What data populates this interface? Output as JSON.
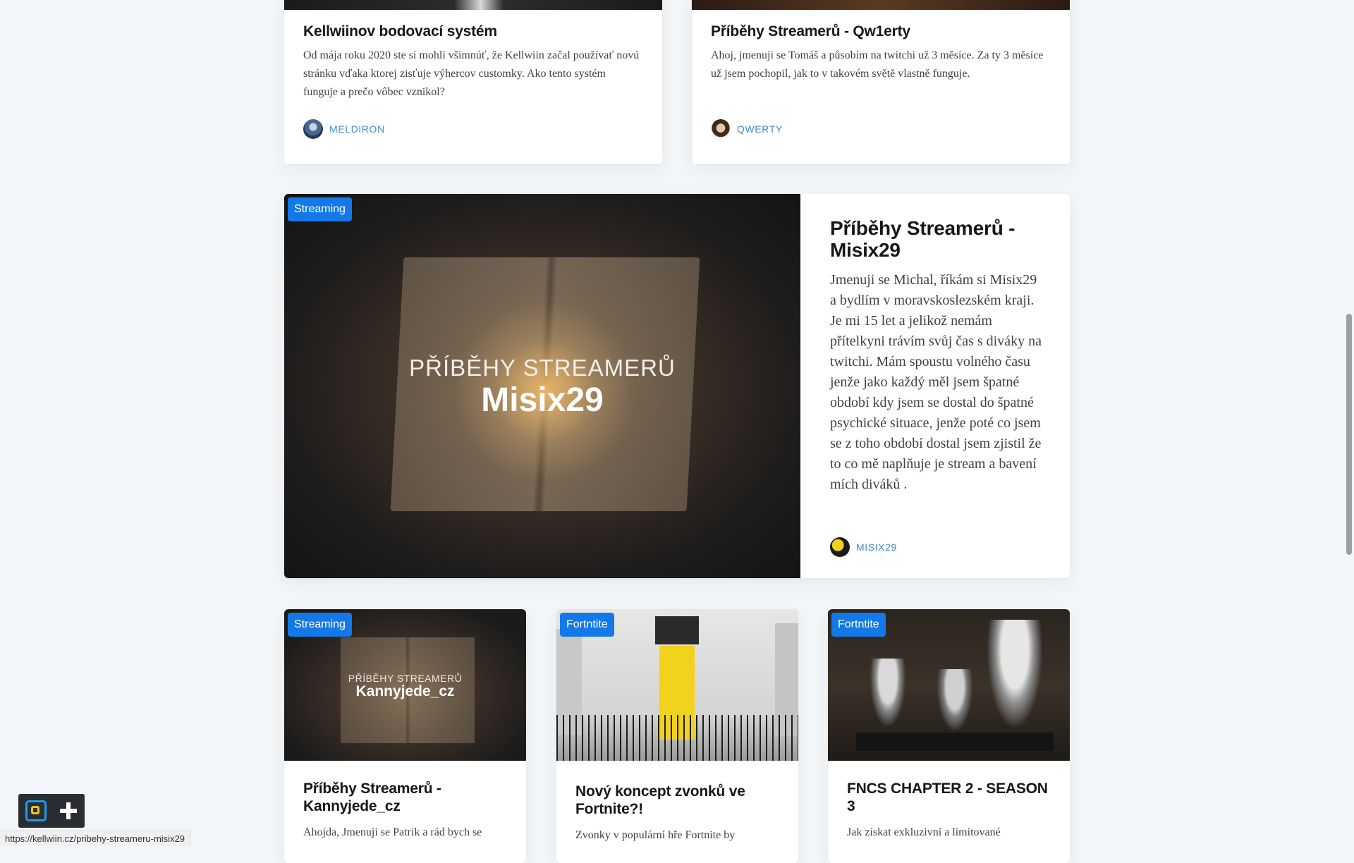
{
  "top_cards": [
    {
      "title": "Kellwiinov bodovací systém",
      "excerpt": "Od mája roku 2020 ste si mohli všimnúť, že Kellwiin začal používať novú stránku vďaka ktorej zisťuje výhercov customky. Ako tento systém funguje a prečo vôbec vznikol?",
      "author": "MELDIRON"
    },
    {
      "title": "Příběhy Streamerů - Qw1erty",
      "excerpt": "Ahoj, jmenuji se Tomáš a působím na twitchi už 3 měsíce. Za ty 3 měsíce už jsem pochopil, jak to v takovém světě vlastně funguje.",
      "author": "QWERTY"
    }
  ],
  "featured": {
    "tag": "Streaming",
    "image_line1": "PŘÍBĚHY STREAMERŮ",
    "image_line2": "Misix29",
    "title": "Příběhy Streamerů - Misix29",
    "excerpt": "Jmenuji se Michal, říkám si Misix29 a bydlím v moravskoslezském kraji. Je mi 15 let a jelikož nemám přítelkyni trávím svůj čas s diváky na twitchi. Mám spoustu volného času jenže jako každý měl jsem špatné období kdy jsem se dostal do špatné psychické situace, jenže poté co jsem se z toho období dostal jsem zjistil že to co mě naplňuje je stream a bavení mích diváků .",
    "author": "MISIX29"
  },
  "bottom_cards": [
    {
      "tag": "Streaming",
      "image_line1": "PŘÍBĚHY STREAMERŮ",
      "image_line2": "Kannyjede_cz",
      "title": "Příběhy Streamerů - Kannyjede_cz",
      "excerpt": "Ahojda, Jmenuji se Patrik a rád bych se"
    },
    {
      "tag": "Fortntite",
      "title": "Nový koncept zvonků ve Fortnite?!",
      "excerpt": "Zvonky v populární hře Fortnite by"
    },
    {
      "tag": "Fortntite",
      "title": "FNCS CHAPTER 2 - SEASON 3",
      "excerpt": "Jak získat exkluzivní a limitované"
    }
  ],
  "status_url": "https://kellwiin.cz/pribehy-streameru-misix29",
  "colors": {
    "accent": "#1379e8",
    "author": "#3e8ed0",
    "background": "#f3f6f9"
  }
}
